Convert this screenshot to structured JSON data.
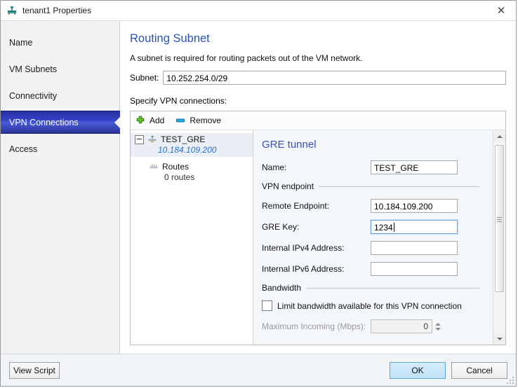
{
  "window": {
    "title": "tenant1 Properties",
    "icon": "network-tenant-icon",
    "close_label": "✕"
  },
  "sidebar": {
    "items": [
      {
        "label": "Name",
        "selected": false
      },
      {
        "label": "VM Subnets",
        "selected": false
      },
      {
        "label": "Connectivity",
        "selected": false
      },
      {
        "label": "VPN Connections",
        "selected": true
      },
      {
        "label": "Access",
        "selected": false
      }
    ]
  },
  "main": {
    "page_title": "Routing Subnet",
    "description": "A subnet is required for routing packets out of the VM network.",
    "subnet_label": "Subnet:",
    "subnet_value": "10.252.254.0/29",
    "specify_label": "Specify VPN connections:"
  },
  "toolbar": {
    "add_label": "Add",
    "remove_label": "Remove"
  },
  "tree": {
    "root": {
      "label": "TEST_GRE",
      "address": "10.184.109.200"
    },
    "child": {
      "label": "Routes",
      "count_text": "0 routes"
    }
  },
  "detail": {
    "heading": "GRE tunnel",
    "name_label": "Name:",
    "name_value": "TEST_GRE",
    "endpoint_group": "VPN endpoint",
    "remote_endpoint_label": "Remote Endpoint:",
    "remote_endpoint_value": "10.184.109.200",
    "gre_key_label": "GRE Key:",
    "gre_key_value": "1234",
    "internal_ipv4_label": "Internal IPv4 Address:",
    "internal_ipv4_value": "",
    "internal_ipv6_label": "Internal IPv6 Address:",
    "internal_ipv6_value": "",
    "bandwidth_group": "Bandwidth",
    "limit_checkbox_label": "Limit bandwidth available for this VPN connection",
    "max_incoming_label": "Maximum Incoming (Mbps):",
    "max_incoming_value": "0"
  },
  "footer": {
    "view_script_label": "View Script",
    "ok_label": "OK",
    "cancel_label": "Cancel"
  },
  "colors": {
    "accent_title": "#2a52be",
    "detail_heading": "#3b4fb8",
    "selected_nav": "#3340c4",
    "tree_address": "#2a6fd6",
    "add_icon": "#5bb82f",
    "remove_icon": "#1e9ae0"
  }
}
